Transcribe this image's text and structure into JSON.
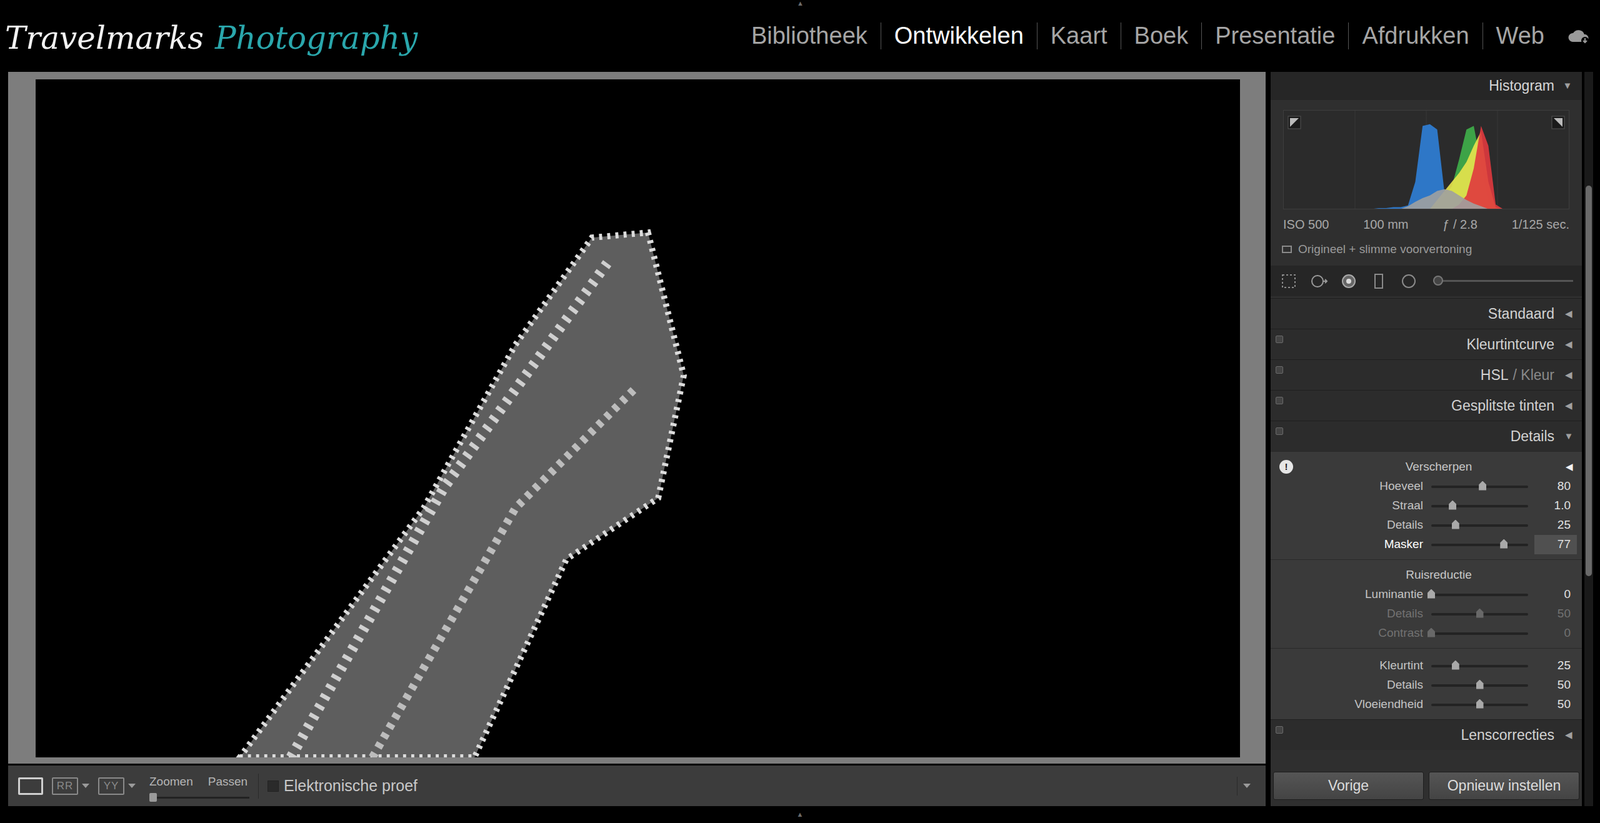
{
  "logo": {
    "name": "Travelmarks",
    "accent": "Photography"
  },
  "modules": [
    {
      "label": "Bibliotheek",
      "selected": false
    },
    {
      "label": "Ontwikkelen",
      "selected": true
    },
    {
      "label": "Kaart",
      "selected": false
    },
    {
      "label": "Boek",
      "selected": false
    },
    {
      "label": "Presentatie",
      "selected": false
    },
    {
      "label": "Afdrukken",
      "selected": false
    },
    {
      "label": "Web",
      "selected": false
    }
  ],
  "panel_toggles": [
    "▲",
    "▲"
  ],
  "bottom_toolbar": {
    "view_icons": [
      "RR",
      "YY"
    ],
    "zoom_labels": [
      "Zoomen",
      "Passen"
    ],
    "zoom_level": 0,
    "soft_proof": {
      "label": "Elektronische proef",
      "checked": false
    }
  },
  "histogram": {
    "title": "Histogram",
    "arrow": "▼",
    "series": [
      {
        "color": "#2f7fd8",
        "values": [
          0,
          0,
          0,
          0,
          0,
          0,
          0,
          0,
          0,
          0,
          0,
          0,
          0,
          1,
          1,
          2,
          2,
          4,
          30,
          92,
          94,
          88,
          18,
          8,
          5,
          3,
          2,
          1,
          0,
          0,
          0,
          0,
          0,
          0,
          0,
          0,
          0,
          0,
          0,
          0
        ]
      },
      {
        "color": "#3fb04a",
        "values": [
          0,
          0,
          0,
          0,
          0,
          0,
          0,
          0,
          0,
          0,
          0,
          0,
          0,
          0,
          0,
          0,
          0,
          0,
          0,
          0,
          0,
          6,
          14,
          25,
          55,
          88,
          92,
          50,
          8,
          0,
          0,
          0,
          0,
          0,
          0,
          0,
          0,
          0,
          0,
          0
        ]
      },
      {
        "color": "#e8e44c",
        "values": [
          0,
          0,
          0,
          0,
          0,
          0,
          0,
          0,
          0,
          0,
          0,
          0,
          0,
          0,
          0,
          0,
          0,
          0,
          0,
          0,
          0,
          10,
          20,
          30,
          40,
          52,
          70,
          86,
          30,
          2,
          0,
          0,
          0,
          0,
          0,
          0,
          0,
          0,
          0,
          0
        ]
      },
      {
        "color": "#e0383e",
        "values": [
          0,
          0,
          0,
          0,
          0,
          0,
          0,
          0,
          0,
          0,
          0,
          0,
          0,
          0,
          0,
          0,
          0,
          0,
          0,
          0,
          0,
          0,
          0,
          0,
          5,
          15,
          45,
          92,
          70,
          5,
          0,
          0,
          0,
          0,
          0,
          0,
          0,
          0,
          0,
          0
        ]
      },
      {
        "color": "#a0a0a0",
        "values": [
          0,
          0,
          0,
          0,
          0,
          0,
          0,
          0,
          0,
          0,
          0,
          0,
          0,
          0,
          0,
          0,
          0,
          3,
          8,
          12,
          15,
          20,
          22,
          20,
          15,
          10,
          6,
          3,
          0,
          0,
          0,
          0,
          0,
          0,
          0,
          0,
          0,
          0,
          0,
          0
        ]
      }
    ],
    "info": [
      "ISO 500",
      "100 mm",
      "ƒ / 2.8",
      "1/125 sec."
    ],
    "preview": "Origineel + slimme voorvertoning"
  },
  "tools": {
    "slider_level": 0
  },
  "panels": [
    {
      "title": "Standaard",
      "arrow": "◀",
      "expanded": false,
      "kind": "basic"
    },
    {
      "title": "Kleurtintcurve",
      "arrow": "◀",
      "expanded": false,
      "kind": "toggleable"
    },
    {
      "title": "HSL",
      "extra": "/ Kleur",
      "arrow": "◀",
      "expanded": false,
      "kind": "toggleable"
    },
    {
      "title": "Gesplitste tinten",
      "arrow": "◀",
      "expanded": false,
      "kind": "toggleable"
    },
    {
      "title": "Details",
      "arrow": "▼",
      "expanded": true,
      "kind": "toggleable",
      "sections": [
        {
          "title": "Verscherpen",
          "badge": "!",
          "arrow": "◀",
          "sliders": [
            {
              "label": "Hoeveel",
              "value": "80",
              "level": 0.53,
              "disabled": false,
              "active": false
            },
            {
              "label": "Straal",
              "value": "1.0",
              "level": 0.22,
              "disabled": false,
              "active": false
            },
            {
              "label": "Details",
              "value": "25",
              "level": 0.25,
              "disabled": false,
              "active": false
            },
            {
              "label": "Masker",
              "value": "77",
              "level": 0.75,
              "disabled": false,
              "active": true
            }
          ]
        },
        {
          "title": "Ruisreductie",
          "sliders": [
            {
              "label": "Luminantie",
              "value": "0",
              "level": 0,
              "disabled": false,
              "active": false
            },
            {
              "label": "Details",
              "value": "50",
              "level": 0.5,
              "disabled": true,
              "active": false
            },
            {
              "label": "Contrast",
              "value": "0",
              "level": 0,
              "disabled": true,
              "active": false
            }
          ]
        },
        {
          "sliders": [
            {
              "label": "Kleurtint",
              "value": "25",
              "level": 0.25,
              "disabled": false,
              "active": false
            },
            {
              "label": "Details",
              "value": "50",
              "level": 0.5,
              "disabled": false,
              "active": false
            },
            {
              "label": "Vloeiendheid",
              "value": "50",
              "level": 0.5,
              "disabled": false,
              "active": false
            }
          ]
        }
      ]
    },
    {
      "title": "Lenscorrecties",
      "arrow": "◀",
      "expanded": false,
      "kind": "toggleable"
    }
  ],
  "buttons": [
    "Vorige",
    "Opnieuw instellen"
  ]
}
